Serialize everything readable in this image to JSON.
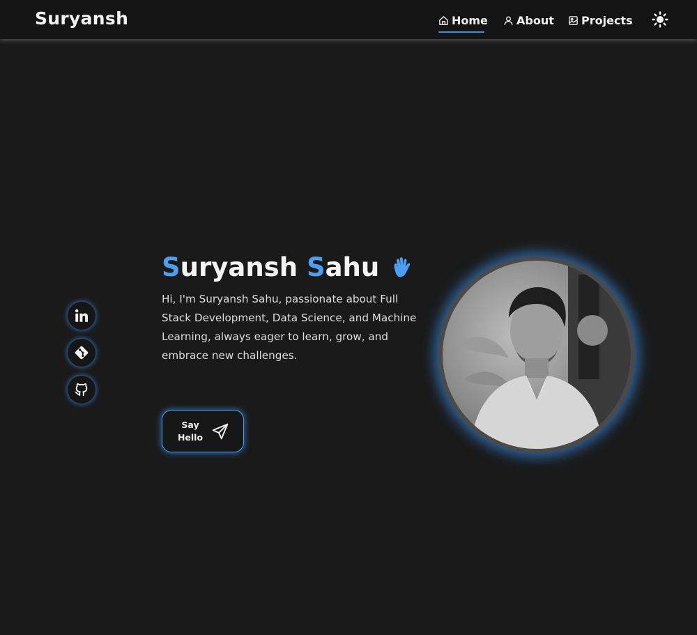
{
  "brand": "Suryansh",
  "nav": {
    "items": [
      {
        "label": "Home",
        "icon": "home-icon",
        "active": true
      },
      {
        "label": "About",
        "icon": "user-icon"
      },
      {
        "label": "Projects",
        "icon": "image-icon"
      }
    ],
    "theme_toggle_icon": "sun-icon"
  },
  "socials": [
    {
      "icon": "linkedin-icon"
    },
    {
      "icon": "git-icon"
    },
    {
      "icon": "github-icon"
    }
  ],
  "hero": {
    "first_initial": "S",
    "first_rest": "uryansh",
    "last_initial": "S",
    "last_rest": "ahu",
    "wave_icon": "waving-hand-icon",
    "intro": "Hi, I'm Suryansh Sahu, passionate about Full Stack Development, Data Science, and Machine Learning, always eager to learn, grow, and embrace new challenges.",
    "button_line1": "Say",
    "button_line2": "Hello",
    "button_icon": "send-icon"
  },
  "colors": {
    "accent": "#4a9ff5",
    "background": "#1a1a1a",
    "navbar": "#141414"
  }
}
